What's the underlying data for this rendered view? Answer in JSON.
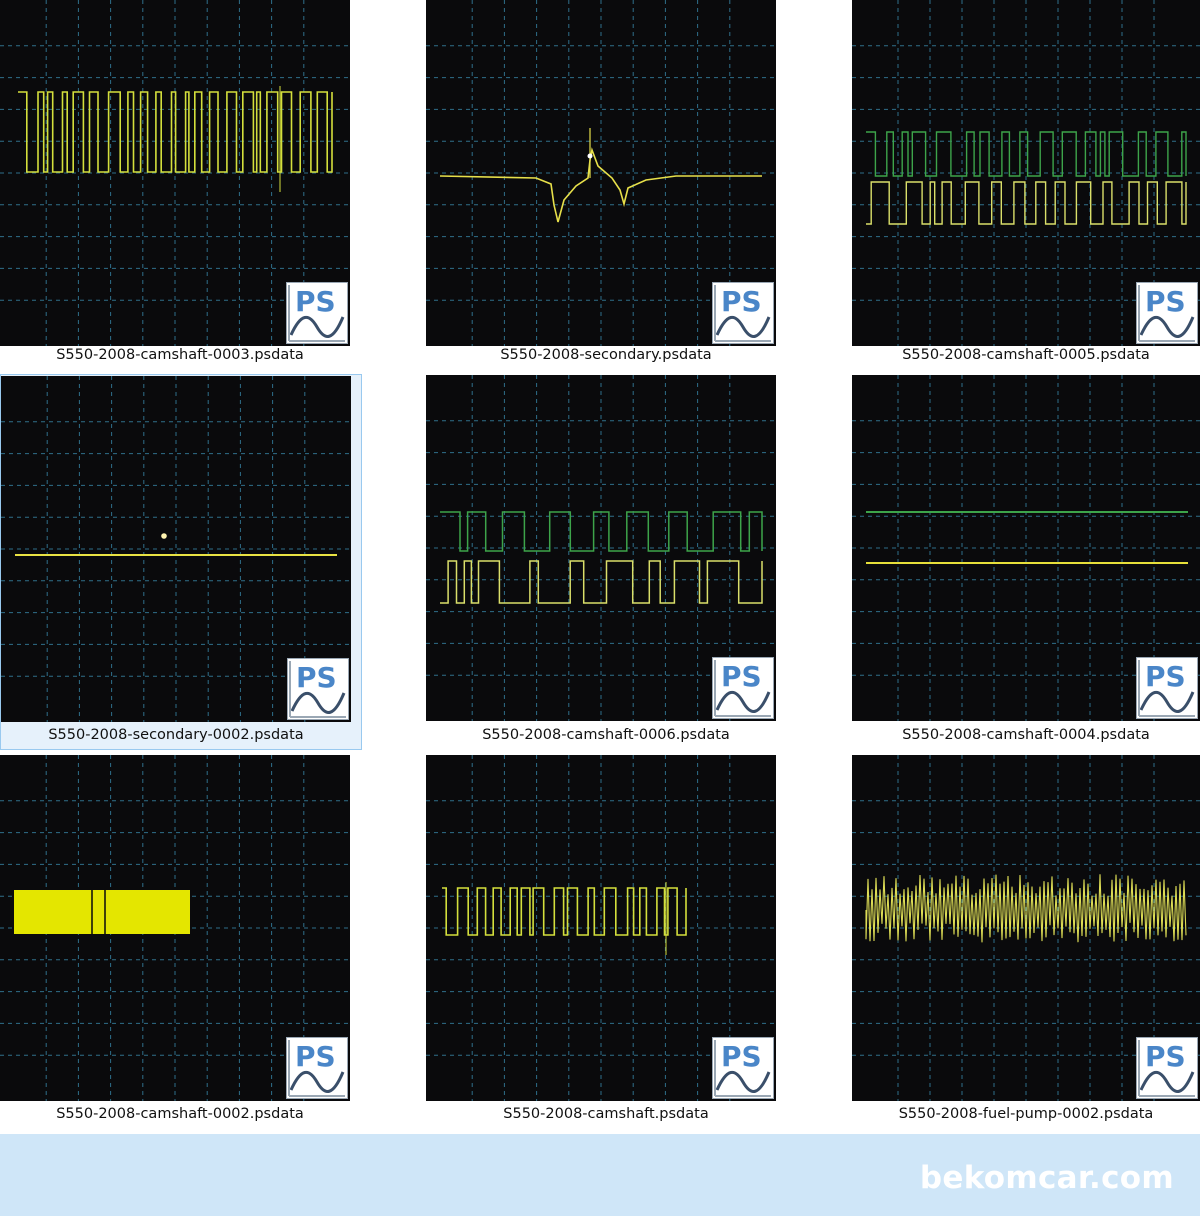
{
  "files": [
    {
      "name": "S550-2008-camshaft-0003.psdata",
      "selected": false,
      "preview": "dense-square-wave",
      "trace_colors": [
        "#d4df3c"
      ]
    },
    {
      "name": "S550-2008-secondary.psdata",
      "selected": false,
      "preview": "ignition-secondary-spike",
      "trace_colors": [
        "#e7e04a"
      ]
    },
    {
      "name": "S550-2008-camshaft-0005.psdata",
      "selected": false,
      "preview": "dual-square-wave",
      "trace_colors": [
        "#3da44a",
        "#dadf6a"
      ]
    },
    {
      "name": "S550-2008-secondary-0002.psdata",
      "selected": true,
      "preview": "flat-line-with-dot",
      "trace_colors": [
        "#e9e243"
      ]
    },
    {
      "name": "S550-2008-camshaft-0006.psdata",
      "selected": false,
      "preview": "dual-square-wave",
      "trace_colors": [
        "#3da44a",
        "#dadf6a"
      ]
    },
    {
      "name": "S550-2008-camshaft-0004.psdata",
      "selected": false,
      "preview": "two-flat-lines",
      "trace_colors": [
        "#3da44a",
        "#e6df3a"
      ]
    },
    {
      "name": "S550-2008-camshaft-0002.psdata",
      "selected": false,
      "preview": "solid-burst-block",
      "trace_colors": [
        "#e4e600"
      ]
    },
    {
      "name": "S550-2008-camshaft.psdata",
      "selected": false,
      "preview": "dense-square-wave",
      "trace_colors": [
        "#d4df3c"
      ]
    },
    {
      "name": "S550-2008-fuel-pump-0002.psdata",
      "selected": false,
      "preview": "noisy-oscillation",
      "trace_colors": [
        "#dcdc55"
      ]
    }
  ],
  "thumbnail_badge": {
    "text": "PS",
    "icon": "picoscope-logo-icon",
    "text_color": "#4a86c8",
    "wave_color": "#3a4f6a"
  },
  "watermark": "bekomcar.com",
  "colors": {
    "scope_background": "#0a0a0c",
    "grid": "#2f6f8a",
    "footer_band": "#cfe6f8",
    "selection": "#99c9ef"
  }
}
